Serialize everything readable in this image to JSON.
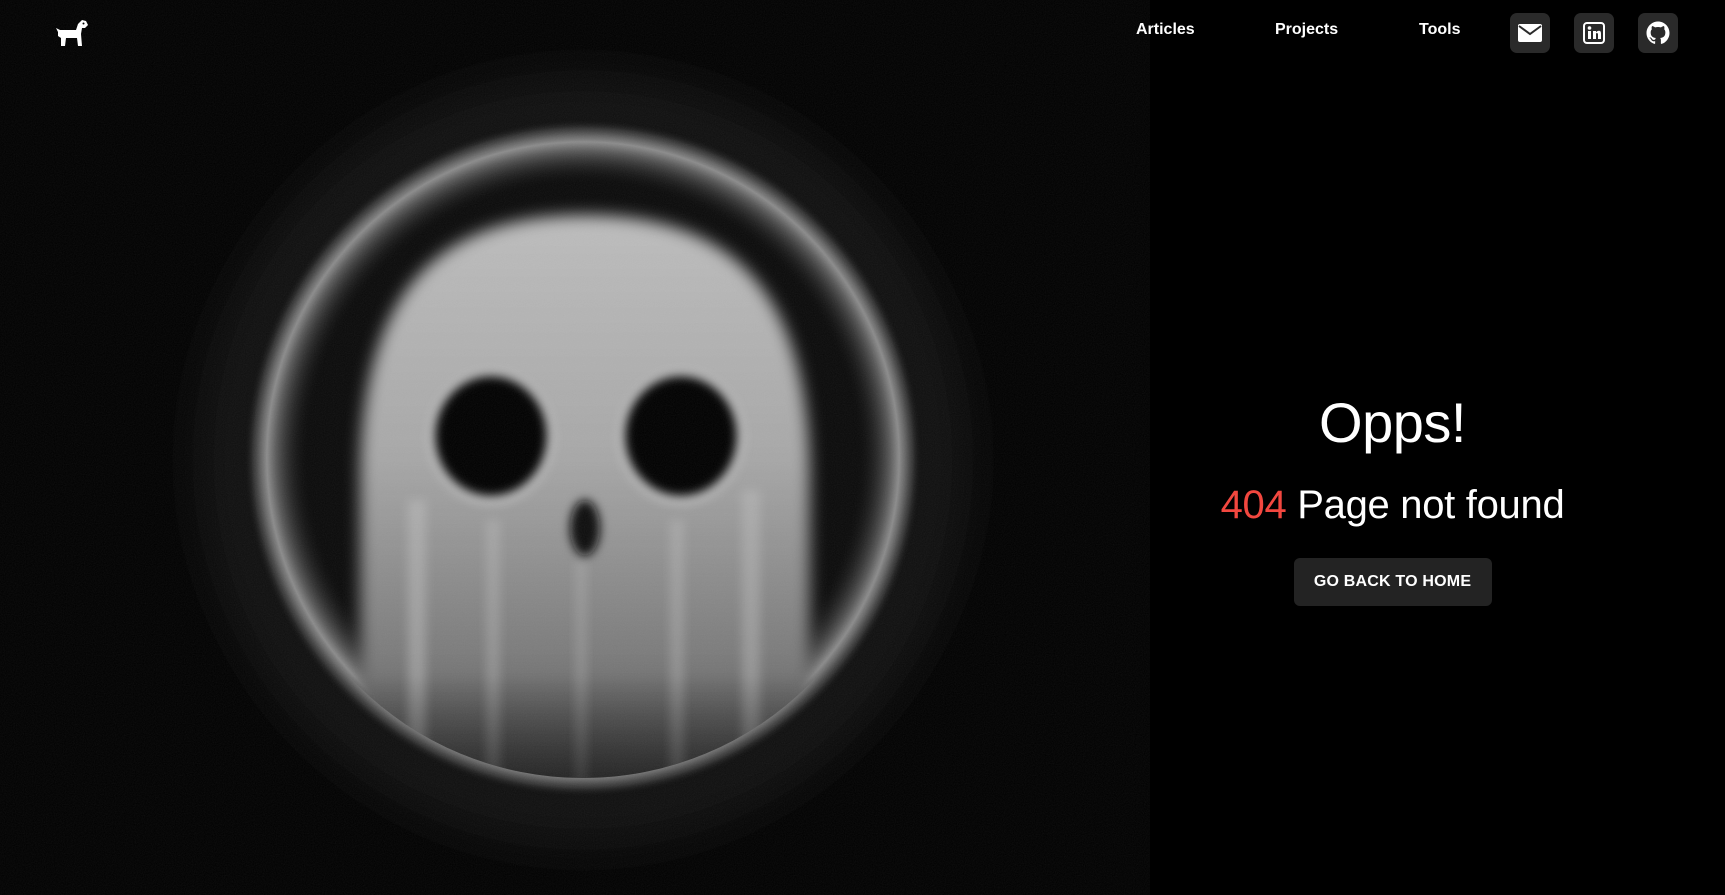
{
  "header": {
    "nav": {
      "articles": "Articles",
      "projects": "Projects",
      "tools": "Tools"
    },
    "icons": {
      "logo": "dog-icon",
      "mail": "envelope-icon",
      "linkedin": "linkedin-icon",
      "github": "github-icon"
    }
  },
  "error": {
    "title": "Opps!",
    "code": "404",
    "message": "Page not found",
    "button_label": "GO BACK TO HOME"
  },
  "colors": {
    "background": "#000000",
    "accent": "#f2473f",
    "button_bg": "#232323",
    "icon_button_bg": "#2a2a2a"
  }
}
